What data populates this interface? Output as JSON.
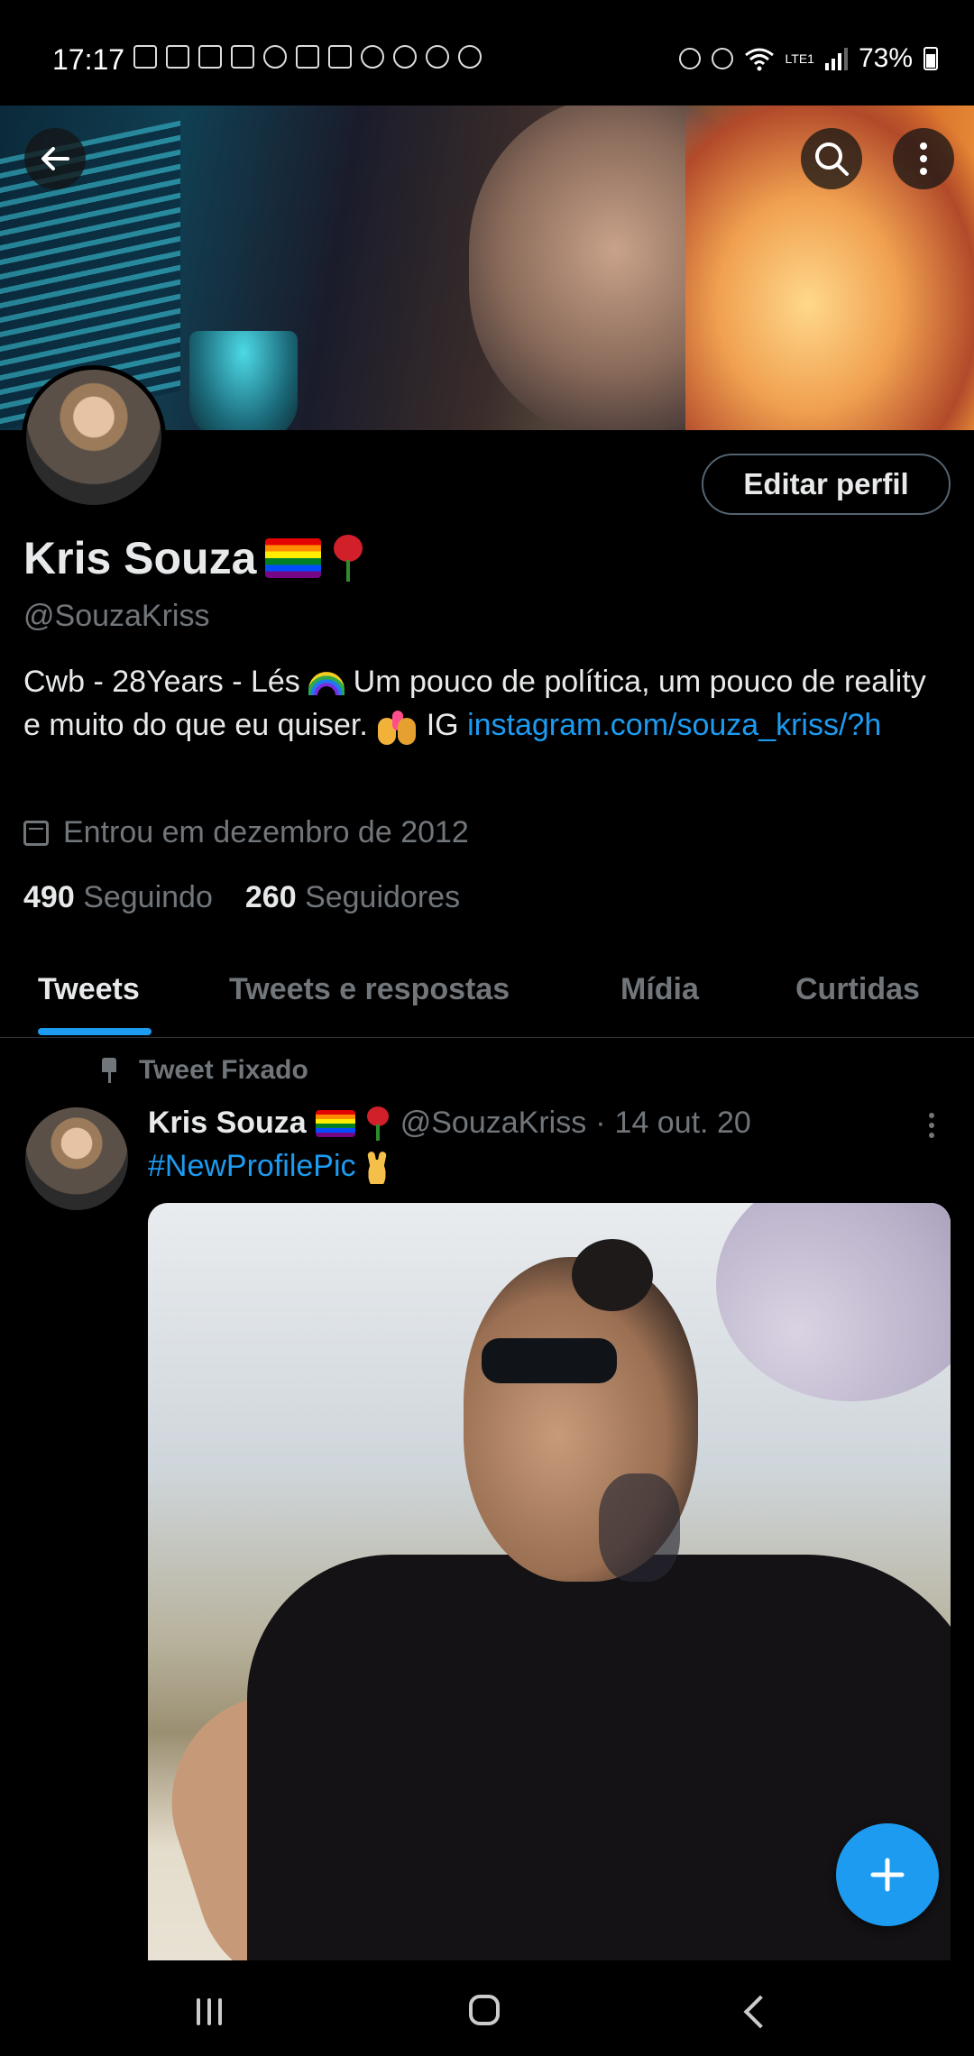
{
  "status_bar": {
    "time": "17:17",
    "battery": "73%",
    "network": "LTE1"
  },
  "header": {
    "back_icon": "arrow-left-icon",
    "search_icon": "search-icon",
    "more_icon": "more-vertical-icon"
  },
  "profile": {
    "name": "Kris Souza",
    "handle": "@SouzaKriss",
    "edit_button": "Editar perfil",
    "bio_part1": "Cwb - 28Years - Lés ",
    "bio_part2": " Um pouco de política, um pouco de reality e muito do que eu quiser. ",
    "bio_part3": " IG ",
    "bio_link": "instagram.com/souza_kriss/?h",
    "joined": "Entrou em dezembro de 2012",
    "following_count": "490",
    "following_label": "Seguindo",
    "followers_count": "260",
    "followers_label": "Seguidores"
  },
  "tabs": [
    {
      "label": "Tweets",
      "active": true
    },
    {
      "label": "Tweets e respostas",
      "active": false
    },
    {
      "label": "Mídia",
      "active": false
    },
    {
      "label": "Curtidas",
      "active": false
    }
  ],
  "pinned_tweet": {
    "pinned_label": "Tweet Fixado",
    "author_name": "Kris Souza",
    "author_handle": "@SouzaKriss",
    "separator": "·",
    "date": "14 out. 20",
    "text": "#NewProfilePic"
  },
  "fab": {
    "icon": "plus-icon"
  },
  "colors": {
    "accent": "#1d9bf0",
    "background": "#000000",
    "secondary_text": "#71767b"
  }
}
